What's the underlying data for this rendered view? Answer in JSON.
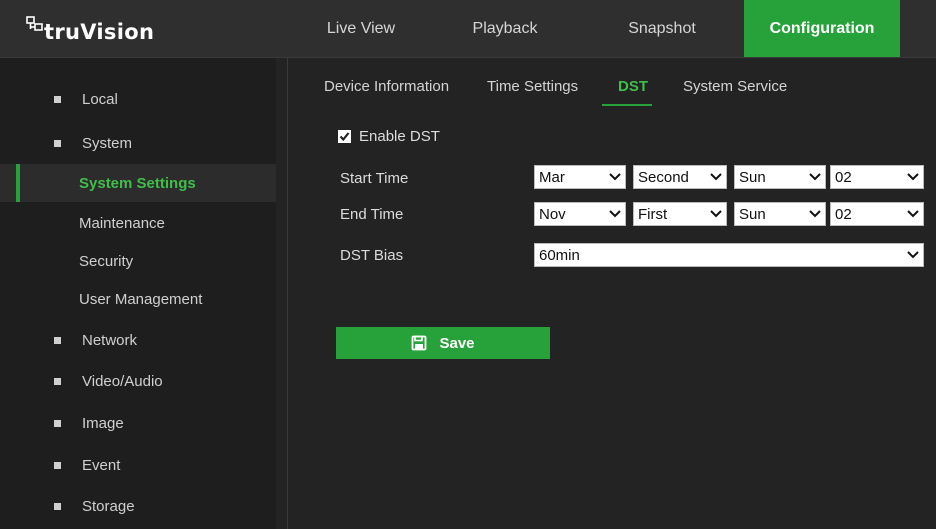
{
  "brand": {
    "name": "truVision",
    "icon": "network-logo-icon"
  },
  "nav": {
    "tabs": [
      {
        "label": "Live View"
      },
      {
        "label": "Playback"
      },
      {
        "label": "Snapshot"
      },
      {
        "label": "Configuration",
        "active": true
      }
    ]
  },
  "sidebar": {
    "items": [
      {
        "label": "Local"
      },
      {
        "label": "System"
      },
      {
        "label": "System Settings",
        "active": true
      },
      {
        "label": "Maintenance"
      },
      {
        "label": "Security"
      },
      {
        "label": "User Management"
      },
      {
        "label": "Network"
      },
      {
        "label": "Video/Audio"
      },
      {
        "label": "Image"
      },
      {
        "label": "Event"
      },
      {
        "label": "Storage"
      }
    ]
  },
  "subtabs": [
    {
      "label": "Device Information"
    },
    {
      "label": "Time Settings"
    },
    {
      "label": "DST",
      "active": true
    },
    {
      "label": "System Service"
    }
  ],
  "form": {
    "enable_dst_label": "Enable DST",
    "enable_dst_checked": true,
    "start_time": {
      "label": "Start Time",
      "month": "Mar",
      "week": "Second",
      "day": "Sun",
      "hour": "02"
    },
    "end_time": {
      "label": "End Time",
      "month": "Nov",
      "week": "First",
      "day": "Sun",
      "hour": "02"
    },
    "dst_bias": {
      "label": "DST Bias",
      "value": "60min"
    },
    "save_label": "Save"
  },
  "colors": {
    "accent": "#27a23a",
    "accent_text": "#3fbf4a",
    "background": "#232323",
    "sidebar": "#1e1e1e",
    "topbar": "#2f2f2f"
  }
}
